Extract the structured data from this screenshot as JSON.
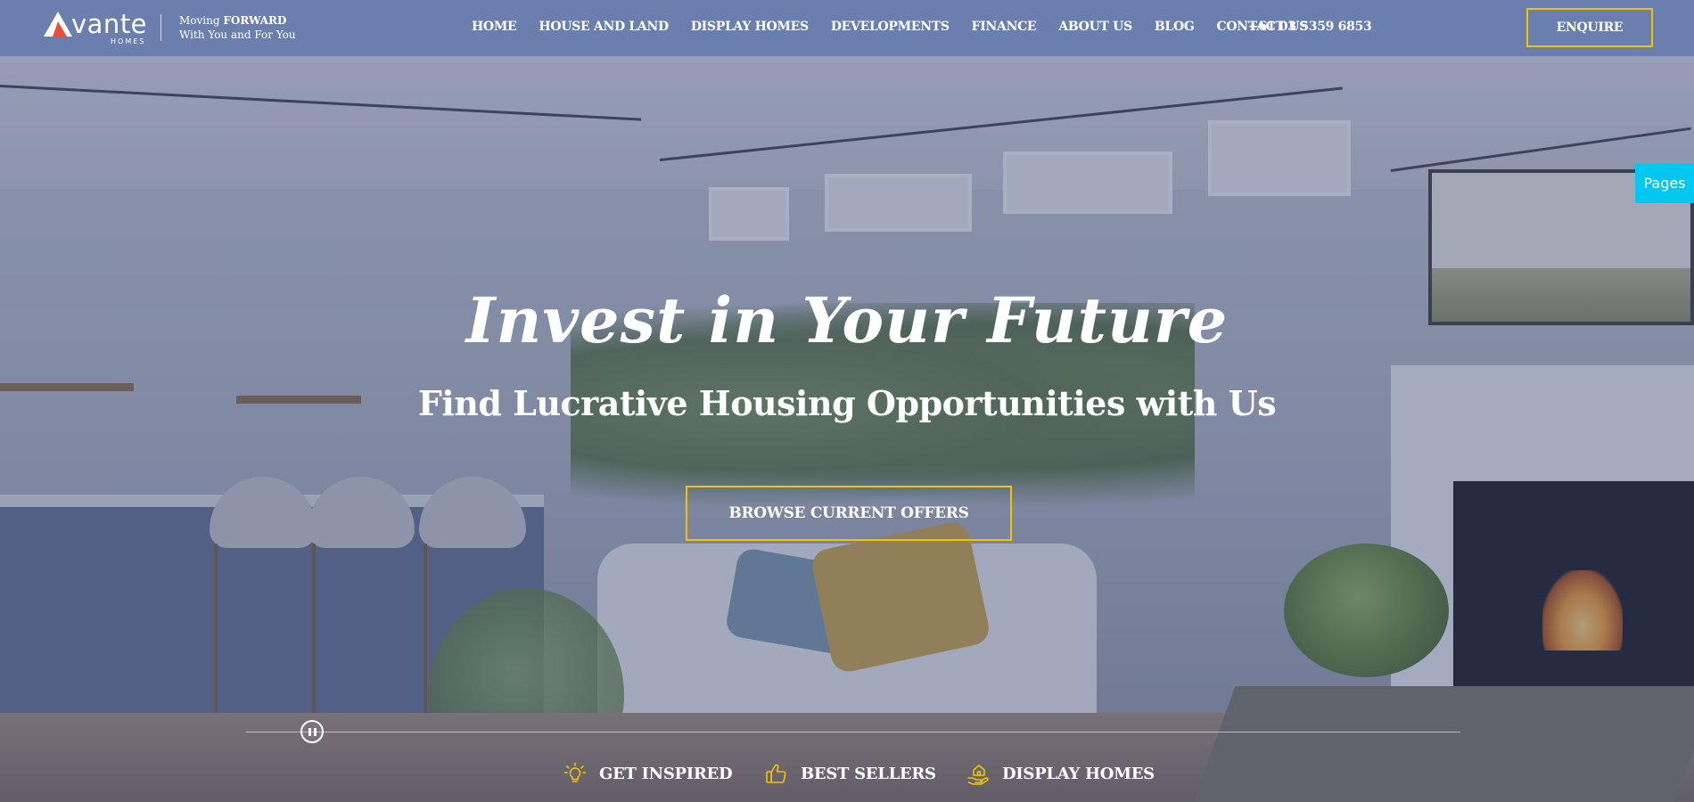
{
  "brand": {
    "logo_word": "vante",
    "logo_sub": "HOMES",
    "tagline_prefix": "Moving ",
    "tagline_bold": "FORWARD",
    "tagline_line2": "With You and For You"
  },
  "nav": {
    "items": [
      {
        "label": "HOME"
      },
      {
        "label": "HOUSE AND LAND"
      },
      {
        "label": "DISPLAY HOMES"
      },
      {
        "label": "DEVELOPMENTS"
      },
      {
        "label": "FINANCE"
      },
      {
        "label": "ABOUT US"
      },
      {
        "label": "BLOG"
      },
      {
        "label": "CONTACT US"
      }
    ],
    "phone": "+61 03 5359 6853",
    "enquire_label": "ENQUIRE"
  },
  "side_tab": {
    "label": "Pages"
  },
  "hero": {
    "title": "Invest in Your Future",
    "subtitle": "Find Lucrative Housing Opportunities with Us",
    "cta_label": "BROWSE CURRENT OFFERS"
  },
  "bottom_links": [
    {
      "label": "GET INSPIRED",
      "icon": "lightbulb-icon"
    },
    {
      "label": "BEST SELLERS",
      "icon": "thumbs-up-icon"
    },
    {
      "label": "DISPLAY HOMES",
      "icon": "hand-house-icon"
    }
  ],
  "colors": {
    "header_bg": "#6b7fae",
    "accent_yellow": "#f2c400",
    "pages_tab": "#00c8f0"
  }
}
